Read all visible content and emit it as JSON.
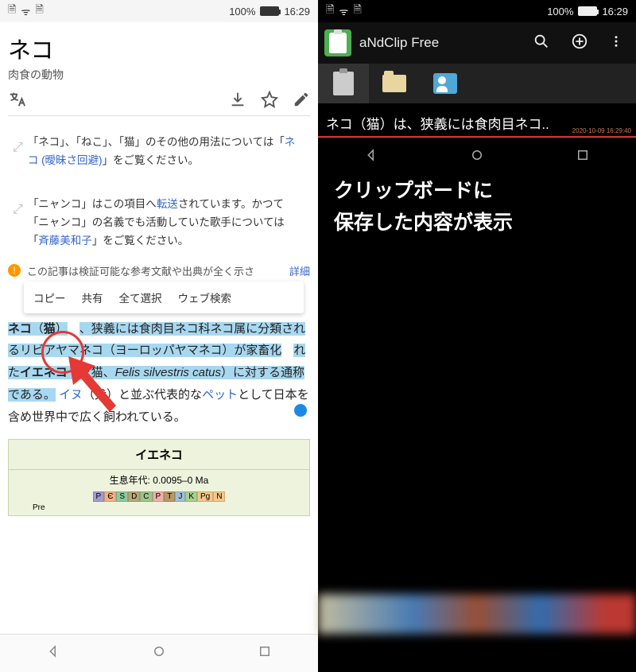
{
  "status": {
    "battery_pct": "100%",
    "time": "16:29"
  },
  "left": {
    "title": "ネコ",
    "subtitle": "肉食の動物",
    "disambig1_pre": "「ネコ」、「ねこ」、「猫」のその他の用法については「",
    "disambig1_link": "ネコ (曖昧さ回避)",
    "disambig1_post": "」をご覧ください。",
    "disambig2_a": "「ニャンコ」はこの項目へ",
    "disambig2_link1": "転送",
    "disambig2_b": "されています。かつて「ニャンコ」の名義でも活動していた歌手については「",
    "disambig2_link2": "斉藤美和子",
    "disambig2_c": "」をご覧ください。",
    "warning": "この記事は検証可能な参考文献や出典が全く示さ",
    "detail": "詳細",
    "context_menu": [
      "コピー",
      "共有",
      "全て選択",
      "ウェブ検索"
    ],
    "article": {
      "s1a": "ネコ",
      "s1b": "（",
      "s1c": "猫",
      "s1d": "）",
      "s1e": "、狭義には食肉目ネコ科ネコ属に分類されるリビアヤマネコ（ヨーロッパヤマネコ）が家畜化",
      "s1f": "れた",
      "s1g": "イエネコ",
      "s1h": "（家猫、",
      "s1i": "Felis silvestris catus",
      "s1j": "）に対する通称である。",
      "s2a": "イヌ",
      "s2b": "（犬）と並ぶ代表的な",
      "s2c": "ペット",
      "s2d": "として日本を含め世界中で広く飼われている。"
    },
    "infobox": {
      "title": "イエネコ",
      "era": "生息年代: 0.0095–0 Ma",
      "timeline": [
        "P",
        "Є",
        "S",
        "D",
        "C",
        "P",
        "T",
        "J",
        "K",
        "Pg",
        "N"
      ],
      "side": "Pre"
    }
  },
  "right": {
    "app_title": "aNdClip Free",
    "clip_text": "ネコ（猫）は、狭義には食肉目ネコ..",
    "clip_timestamp": "2020-10-09 16:29:40",
    "overlay_line1": "クリップボードに",
    "overlay_line2": "保存した内容が表示"
  }
}
